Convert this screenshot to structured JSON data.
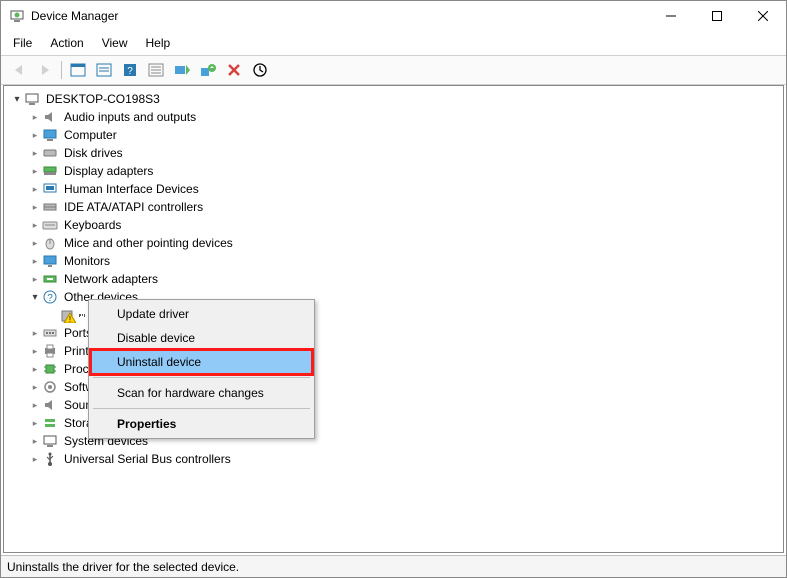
{
  "window": {
    "title": "Device Manager"
  },
  "menu": {
    "file": "File",
    "action": "Action",
    "view": "View",
    "help": "Help"
  },
  "tree": {
    "root": "DESKTOP-CO198S3",
    "categories": {
      "audio": "Audio inputs and outputs",
      "computer": "Computer",
      "disk": "Disk drives",
      "display": "Display adapters",
      "hid": "Human Interface Devices",
      "ide": "IDE ATA/ATAPI controllers",
      "keyboards": "Keyboards",
      "mice": "Mice and other pointing devices",
      "monitors": "Monitors",
      "network": "Network adapters",
      "other": "Other devices",
      "ports": "Ports",
      "printq": "Print queues",
      "processors": "Processors",
      "software": "Software components",
      "sound": "Sound, video and game controllers",
      "storage": "Storage controllers",
      "system": "System devices",
      "usb": "Universal Serial Bus controllers"
    },
    "unknown_device": " "
  },
  "context_menu": {
    "update_driver": "Update driver",
    "disable_device": "Disable device",
    "uninstall_device": "Uninstall device",
    "scan": "Scan for hardware changes",
    "properties": "Properties"
  },
  "status": "Uninstalls the driver for the selected device."
}
